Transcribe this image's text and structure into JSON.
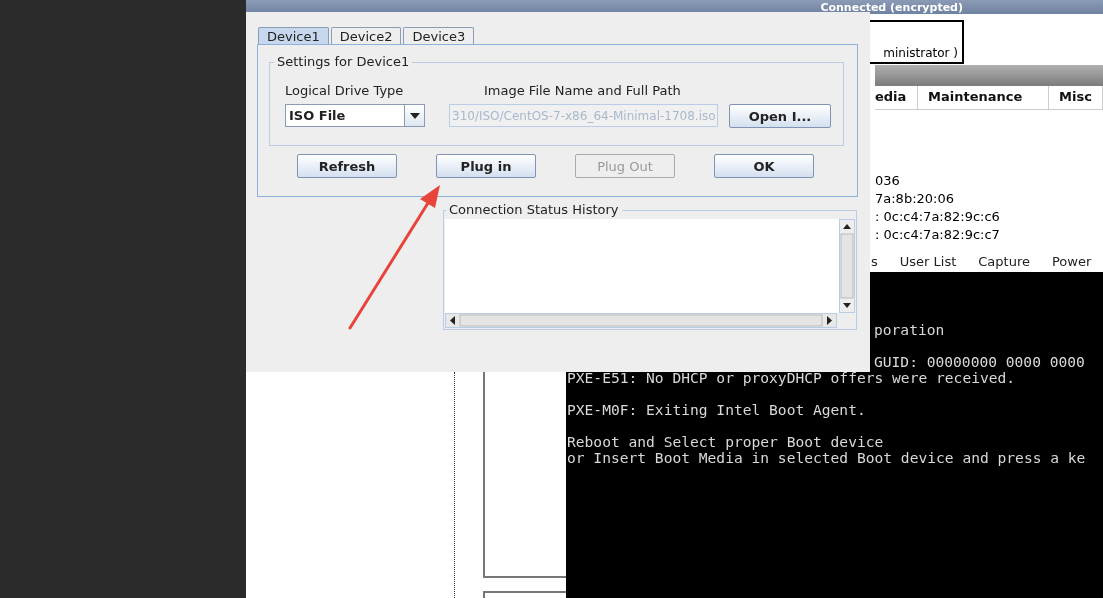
{
  "top_bar": {
    "status": "Connected (encrypted)"
  },
  "background_page": {
    "user_box": "ministrator )",
    "tabs": [
      "edia",
      "Maintenance",
      "Misc"
    ],
    "info_lines": [
      "036",
      "7a:8b:20:06",
      ": 0c:c4:7a:82:9c:c6",
      ": 0c:c4:7a:82:9c:c7"
    ],
    "menu": [
      "s",
      "User List",
      "Capture",
      "Power"
    ],
    "console_lines": [
      {
        "kind": "clipped",
        "text": "poration"
      },
      {
        "kind": "blank"
      },
      {
        "kind": "clipped",
        "text": "GUID: 00000000 0000 0000"
      },
      {
        "kind": "full",
        "text": "PXE-E51: No DHCP or proxyDHCP offers were received."
      },
      {
        "kind": "blank"
      },
      {
        "kind": "full",
        "text": "PXE-M0F: Exiting Intel Boot Agent."
      },
      {
        "kind": "blank"
      },
      {
        "kind": "full",
        "text": "Reboot and Select proper Boot device"
      },
      {
        "kind": "full",
        "text": "or Insert Boot Media in selected Boot device and press a ke"
      }
    ]
  },
  "dialog": {
    "tabs": [
      {
        "label": "Device1",
        "selected": true
      },
      {
        "label": "Device2",
        "selected": false
      },
      {
        "label": "Device3",
        "selected": false
      }
    ],
    "group_title": "Settings for Device1",
    "drive_type_label": "Logical Drive Type",
    "drive_type": {
      "value": "ISO File"
    },
    "path_label": "Image File Name and Full Path",
    "path_field": {
      "value": "310/ISO/CentOS-7-x86_64-Minimal-1708.iso",
      "disabled": true
    },
    "open_button": "Open I...",
    "buttons": [
      {
        "label": "Refresh",
        "disabled": false
      },
      {
        "label": "Plug in",
        "disabled": false
      },
      {
        "label": "Plug Out",
        "disabled": true
      },
      {
        "label": "OK",
        "disabled": false
      }
    ],
    "history": {
      "title": "Connection Status History"
    }
  }
}
